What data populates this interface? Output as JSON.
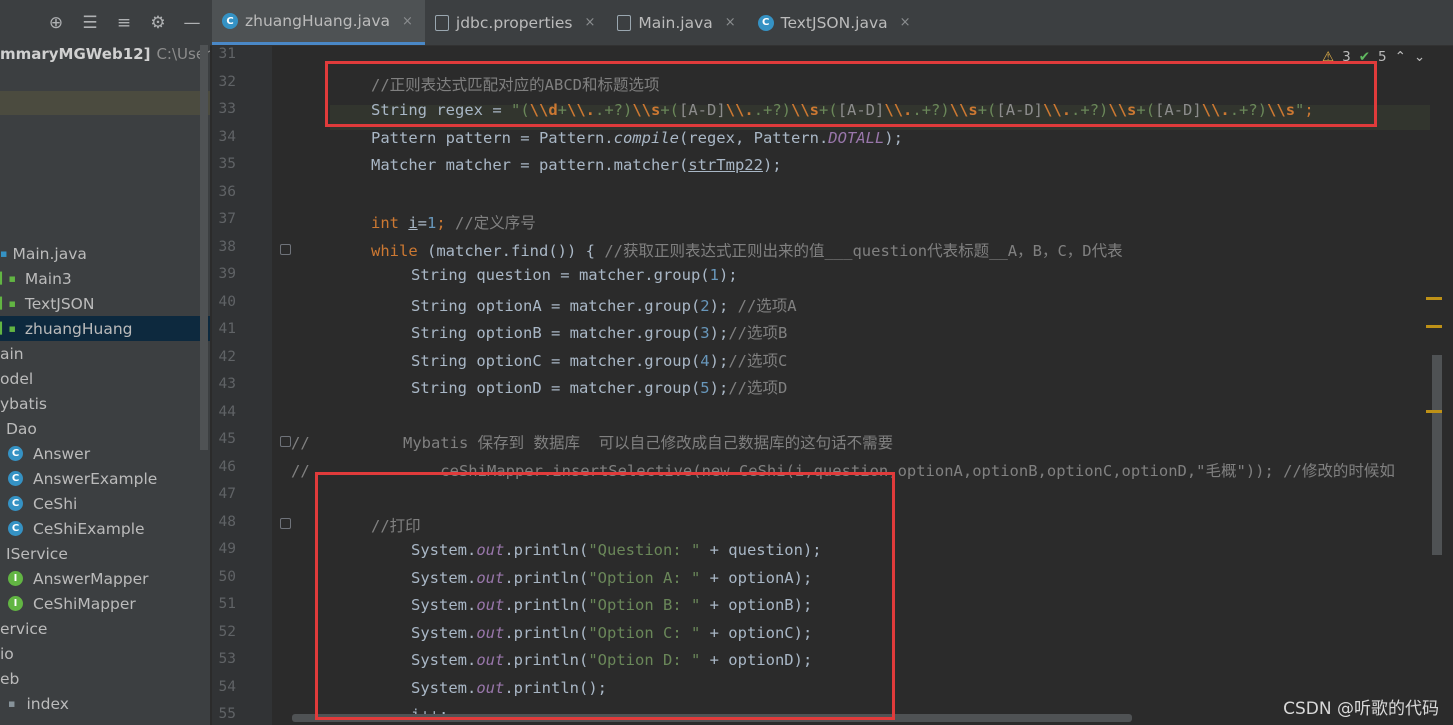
{
  "toolbar": {
    "icons": [
      "target-icon",
      "collapse-all-icon",
      "expand-all-icon",
      "settings-icon",
      "hide-icon"
    ],
    "glyphs": [
      "⊕",
      "☰",
      "≡",
      "⚙",
      "—"
    ]
  },
  "tabs": [
    {
      "label": "zhuangHuang.java",
      "icon": "java-class-icon",
      "active": true
    },
    {
      "label": "jdbc.properties",
      "icon": "properties-file-icon",
      "active": false
    },
    {
      "label": "Main.java",
      "icon": "java-file-icon",
      "active": false
    },
    {
      "label": "TextJSON.java",
      "icon": "java-class-icon",
      "active": false
    }
  ],
  "tab_close_glyph": "×",
  "project": {
    "root_name": "mmaryMGWeb12]",
    "root_path": "C:\\Users\\",
    "items": [
      {
        "label": "Main.java"
      },
      {
        "label": "Main3"
      },
      {
        "label": "TextJSON"
      },
      {
        "label": "zhuangHuang",
        "selected": true
      },
      {
        "label": "ain"
      },
      {
        "label": "odel"
      },
      {
        "label": "ybatis"
      },
      {
        "label": "Dao"
      },
      {
        "label": "Answer"
      },
      {
        "label": "AnswerExample"
      },
      {
        "label": "CeShi"
      },
      {
        "label": "CeShiExample"
      },
      {
        "label": "IService"
      },
      {
        "label": "AnswerMapper"
      },
      {
        "label": "CeShiMapper"
      },
      {
        "label": "ervice"
      },
      {
        "label": "io"
      },
      {
        "label": "eb"
      },
      {
        "label": "index"
      }
    ]
  },
  "inspections": {
    "warnings": "3",
    "ok": "5"
  },
  "editor": {
    "line_numbers": [
      "31",
      "32",
      "33",
      "34",
      "35",
      "36",
      "37",
      "38",
      "39",
      "40",
      "41",
      "42",
      "43",
      "44",
      "45",
      "46",
      "47",
      "48",
      "49",
      "50",
      "51",
      "52",
      "53",
      "54",
      "55"
    ],
    "l32_comment": "//正则表达式匹配对应的ABCD和标题选项",
    "l33": {
      "decl": "String regex = ",
      "q": "\"",
      "p1": "(",
      "e1": "\\\\d",
      "s1": "+",
      "e2": "\\\\.",
      "s2": ".+?)",
      "e3": "\\\\s",
      "s3": "+(",
      "r1": "[A-D]",
      "e4": "\\\\.",
      "s4": ".+?)",
      "e5": "\\\\s",
      "s5": "+(",
      "r2": "[A-D]",
      "e6": "\\\\.",
      "s6": ".+?)",
      "e7": "\\\\s",
      "s7": "+(",
      "r3": "[A-D]",
      "e8": "\\\\.",
      "s8": ".+?)",
      "e9": "\\\\s",
      "s9": "+(",
      "r4": "[A-D]",
      "e10": "\\\\.",
      "s10": ".+?)",
      "e11": "\\\\s",
      "q2": "\"",
      "end": ";"
    },
    "l34": {
      "a": "Pattern pattern = Pattern.",
      "b": "compile",
      "c": "(regex, Pattern.",
      "d": "DOTALL",
      "e": ");"
    },
    "l35": {
      "a": "Matcher matcher = pattern.matcher(",
      "b": "strTmp22",
      "c": ");"
    },
    "l37": {
      "kw": "int ",
      "var": "i",
      "eq": "=",
      "num": "1",
      "semi": "; ",
      "cm": "//定义序号"
    },
    "l38": {
      "kw": "while ",
      "a": "(matcher.find()) { ",
      "cm": "//获取正则表达式正则出来的值___question代表标题__A，B，C，D代表"
    },
    "l39": {
      "a": "String question = matcher.group(",
      "n": "1",
      "b": ");"
    },
    "l40": {
      "a": "String optionA = matcher.group(",
      "n": "2",
      "b": "); ",
      "cm": "//选项A"
    },
    "l41": {
      "a": "String optionB = matcher.group(",
      "n": "3",
      "b": ");",
      "cm": "//选项B"
    },
    "l42": {
      "a": "String optionC = matcher.group(",
      "n": "4",
      "b": ");",
      "cm": "//选项C"
    },
    "l43": {
      "a": "String optionD = matcher.group(",
      "n": "5",
      "b": ");",
      "cm": "//选项D"
    },
    "l45": "//          Mybatis 保存到 数据库  可以自己修改成自己数据库的这句话不需要",
    "l46": "//              ceShiMapper.insertSelective(new CeShi(i,question,optionA,optionB,optionC,optionD,\"毛概\")); //修改的时候如",
    "l48_comment": "//打印",
    "println": [
      {
        "a": "System.",
        "out": "out",
        "b": ".println(",
        "s": "\"Question: \"",
        "c": " + question);"
      },
      {
        "a": "System.",
        "out": "out",
        "b": ".println(",
        "s": "\"Option A: \"",
        "c": " + optionA);"
      },
      {
        "a": "System.",
        "out": "out",
        "b": ".println(",
        "s": "\"Option B: \"",
        "c": " + optionB);"
      },
      {
        "a": "System.",
        "out": "out",
        "b": ".println(",
        "s": "\"Option C: \"",
        "c": " + optionC);"
      },
      {
        "a": "System.",
        "out": "out",
        "b": ".println(",
        "s": "\"Option D: \"",
        "c": " + optionD);"
      },
      {
        "a": "System.",
        "out": "out",
        "b": ".println();",
        "s": "",
        "c": ""
      }
    ],
    "l55": "i++;"
  },
  "watermark": "CSDN @听歌的代码",
  "colors": {
    "keyword": "#cc7832",
    "string": "#6a8759",
    "comment": "#808080",
    "number": "#6897bb",
    "highlight_box": "#e03b3b"
  }
}
